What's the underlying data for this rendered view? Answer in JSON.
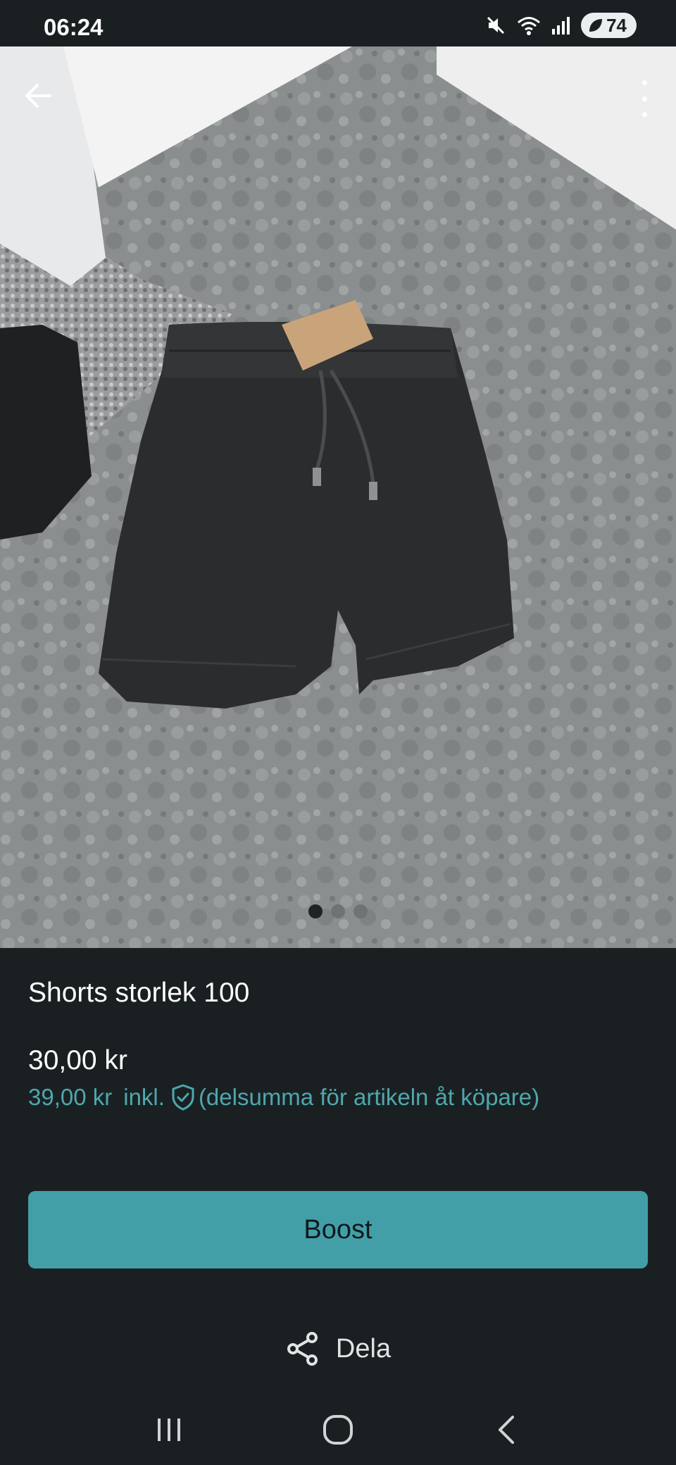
{
  "status_bar": {
    "time": "06:24",
    "battery_level": "74",
    "icons": [
      "mute-icon",
      "wifi-icon",
      "signal-icon",
      "battery-icon"
    ]
  },
  "listing": {
    "image_count": 3,
    "current_image_index": 0,
    "title": "Shorts storlek 100",
    "price": "30,00 kr",
    "price_with_fee": "39,00 kr",
    "incl_label": "inkl.",
    "fee_note": "(delsumma för artikeln åt köpare)"
  },
  "actions": {
    "boost_label": "Boost",
    "share_label": "Dela"
  },
  "colors": {
    "background": "#1a2022",
    "accent": "#429fa8",
    "accent_text": "#4ea7ae"
  }
}
